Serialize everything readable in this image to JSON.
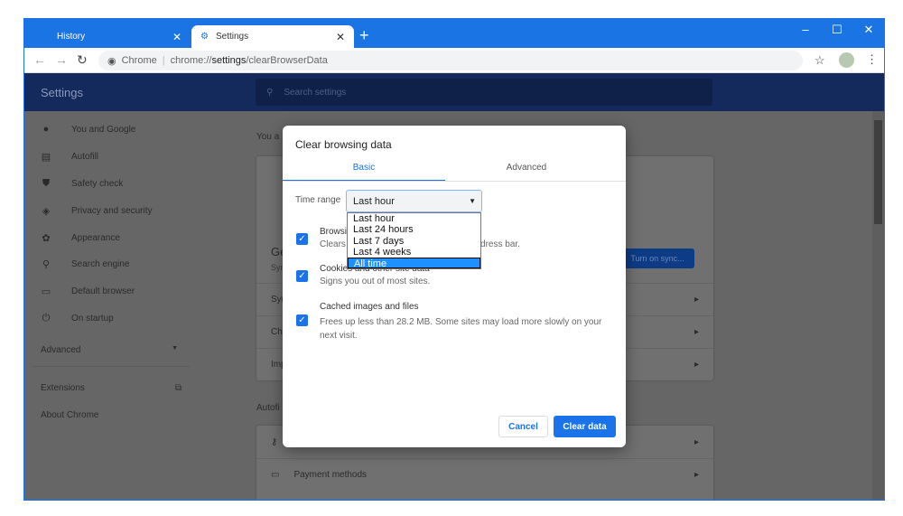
{
  "browser": {
    "tabs": [
      {
        "label": "History"
      },
      {
        "label": "Settings"
      }
    ],
    "omnibox": {
      "site_label": "Chrome",
      "url_prefix": "chrome://",
      "url_host": "settings",
      "url_path": "/clearBrowserData"
    }
  },
  "settings": {
    "title": "Settings",
    "search_placeholder": "Search settings",
    "sidebar": {
      "items": [
        {
          "label": "You and Google",
          "icon": "person-icon"
        },
        {
          "label": "Autofill",
          "icon": "clipboard-icon"
        },
        {
          "label": "Safety check",
          "icon": "shield-check-icon"
        },
        {
          "label": "Privacy and security",
          "icon": "shield-icon"
        },
        {
          "label": "Appearance",
          "icon": "palette-icon"
        },
        {
          "label": "Search engine",
          "icon": "search-icon"
        },
        {
          "label": "Default browser",
          "icon": "browser-icon"
        },
        {
          "label": "On startup",
          "icon": "power-icon"
        }
      ],
      "advanced": "Advanced",
      "extensions": "Extensions",
      "about": "About Chrome"
    },
    "main": {
      "you_heading": "You a",
      "get_heading": "Ge",
      "get_sub": "Syn",
      "sync_button": "Turn on sync...",
      "rows": [
        "Syn",
        "Chr",
        "Imp"
      ],
      "autofill_heading": "Autofi",
      "autofill_rows": [
        {
          "label": "",
          "icon": "key-icon"
        },
        {
          "label": "Payment methods",
          "icon": "credit-card-icon"
        }
      ]
    }
  },
  "dialog": {
    "title": "Clear browsing data",
    "tabs": {
      "basic": "Basic",
      "advanced": "Advanced"
    },
    "time_range_label": "Time range",
    "time_range_value": "Last hour",
    "options": [
      "Last hour",
      "Last 24 hours",
      "Last 7 days",
      "Last 4 weeks",
      "All time"
    ],
    "highlighted_option": "All time",
    "items": [
      {
        "title": "Browsi",
        "desc_start": "Clears",
        "desc_end": "address bar.",
        "checked": true
      },
      {
        "title": "Cookies and other site data",
        "desc": "Signs you out of most sites.",
        "checked": true
      },
      {
        "title": "Cached images and files",
        "desc": "Frees up less than 28.2 MB. Some sites may load more slowly on your next visit.",
        "checked": true
      }
    ],
    "cancel": "Cancel",
    "clear": "Clear data"
  },
  "colors": {
    "accent": "#1a73e8",
    "header": "#14295c",
    "tabbar": "#1b74e4"
  }
}
